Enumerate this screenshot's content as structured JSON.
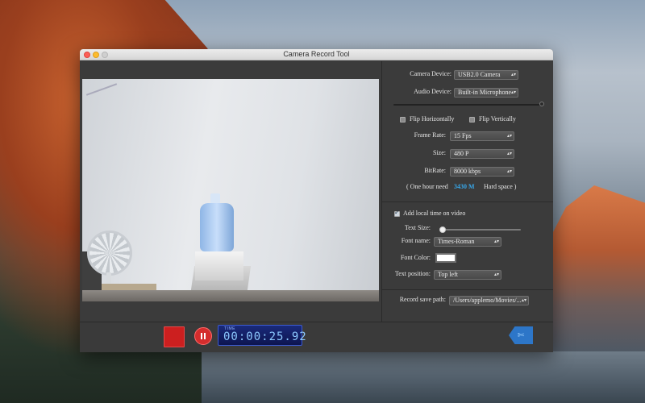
{
  "window": {
    "title": "Camera Record Tool"
  },
  "settings": {
    "camera_device_label": "Camera Device:",
    "camera_device_value": "USB2.0 Camera",
    "audio_device_label": "Audio Device:",
    "audio_device_value": "Built-in Microphone",
    "audio_level": 1.0,
    "flip_horizontal_label": "Flip Horizontally",
    "flip_horizontal_checked": false,
    "flip_vertical_label": "Flip Vertically",
    "flip_vertical_checked": false,
    "frame_rate_label": "Frame Rate:",
    "frame_rate_value": "15 Fps",
    "size_label": "Size:",
    "size_value": "480 P",
    "bitrate_label": "BitRate:",
    "bitrate_value": "8000 kbps",
    "hour_need_prefix": "( One hour need",
    "hour_need_value": "3430 M",
    "hour_need_suffix": "Hard space )"
  },
  "overlay": {
    "local_time_label": "Add local time on video",
    "local_time_checked": true,
    "text_size_label": "Text Size:",
    "text_size_level": 0.0,
    "font_name_label": "Font name:",
    "font_name_value": "Times-Roman",
    "font_color_label": "Font Color:",
    "font_color": "#ffffff",
    "text_position_label": "Text position:",
    "text_position_value": "Top left"
  },
  "save": {
    "path_label": "Record save path:",
    "path_value": "/Users/applemo/Movies/..."
  },
  "controls": {
    "timer_label": "TIME",
    "timer_value": "00:00:25.92",
    "share_icon": "✄"
  },
  "colors": {
    "record_red": "#cc1f1f",
    "timer_blue": "#1a2a7a",
    "accent_blue": "#38a6e8"
  }
}
